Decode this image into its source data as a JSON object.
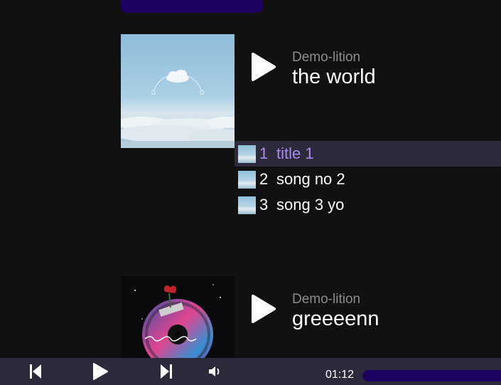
{
  "albums": [
    {
      "artist": "Demo-lition",
      "title": "the world",
      "tracks": [
        {
          "number": "1",
          "name": "title 1",
          "active": true
        },
        {
          "number": "2",
          "name": "song no 2",
          "active": false
        },
        {
          "number": "3",
          "name": "song 3 yo",
          "active": false
        }
      ]
    },
    {
      "artist": "Demo-lition",
      "title": "greeeenn"
    }
  ],
  "player": {
    "time": "01:12",
    "progress": 0
  },
  "colors": {
    "background": "#111111",
    "accent": "#1d0060",
    "active_track_text": "#a98bf0",
    "active_track_bg": "#2e2a3d",
    "player_bg": "#2c2a3a",
    "artist_text": "#8c8c8c"
  },
  "icons": {
    "album_play": "play-icon",
    "previous": "skip-previous-icon",
    "play": "play-icon",
    "next": "skip-next-icon",
    "volume": "volume-icon"
  }
}
